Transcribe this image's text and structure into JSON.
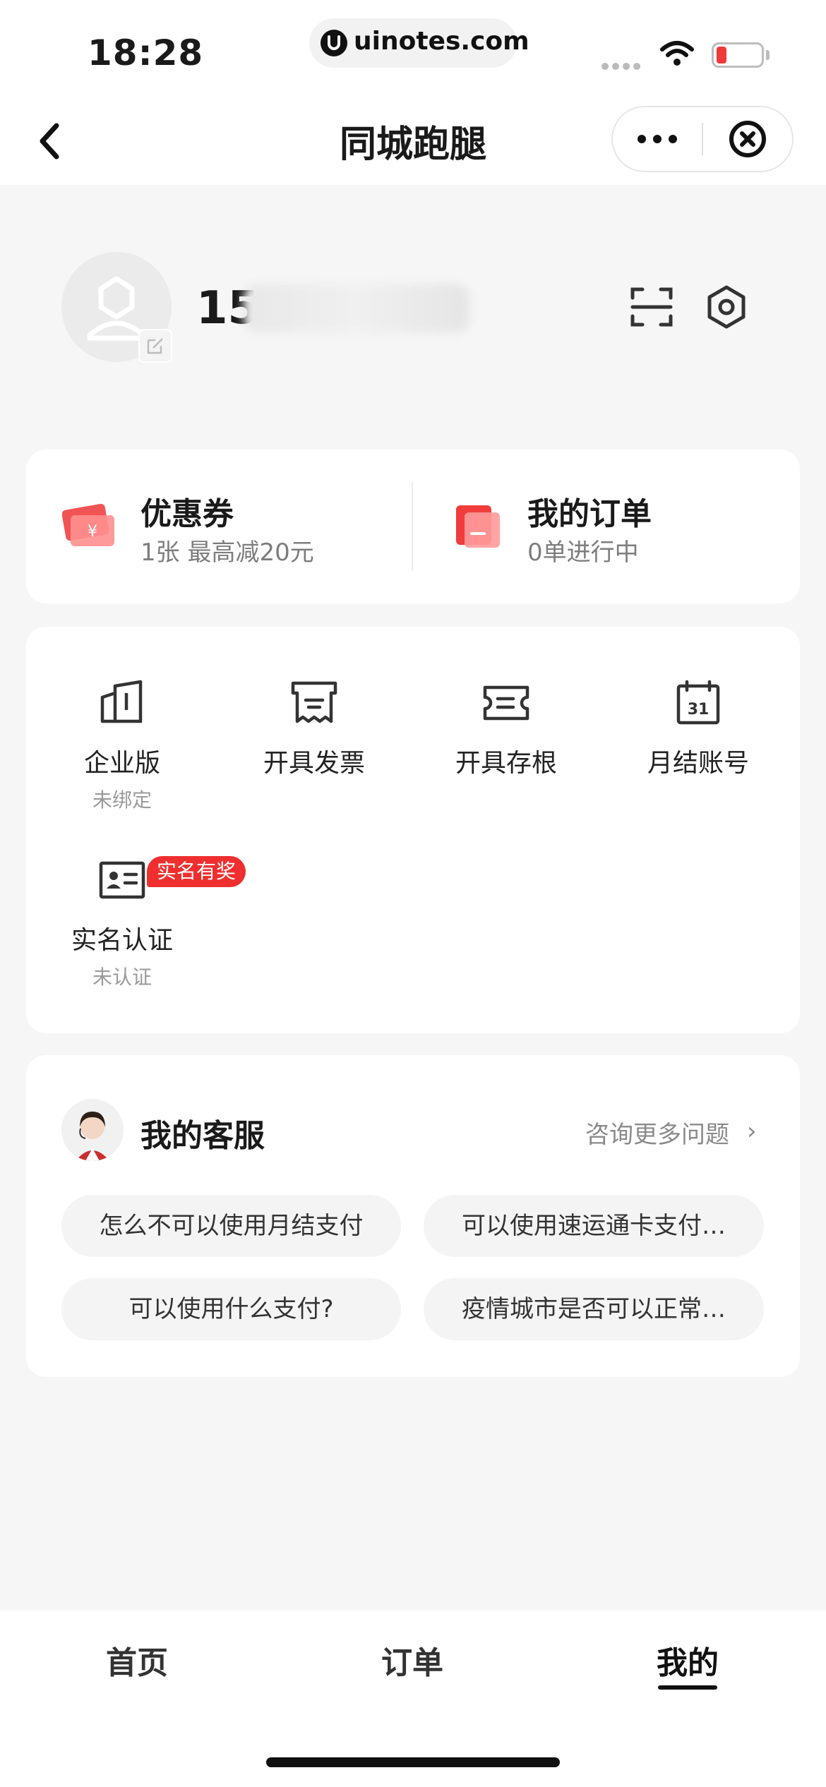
{
  "status_bar": {
    "time": "18:28",
    "url": "uinotes.com"
  },
  "header": {
    "title": "同城跑腿",
    "back_icon": "chevron-left-icon",
    "more_icon": "more-dots-icon",
    "close_icon": "close-circle-icon"
  },
  "profile": {
    "phone_visible": "15",
    "avatar_icon": "user-avatar-icon",
    "edit_icon": "edit-icon",
    "scan_icon": "scan-icon",
    "settings_icon": "settings-hex-icon"
  },
  "summary": {
    "coupon": {
      "title": "优惠券",
      "subtitle": "1张 最高减20元",
      "icon": "coupon-icon"
    },
    "orders": {
      "title": "我的订单",
      "subtitle": "0单进行中",
      "icon": "order-icon"
    }
  },
  "services": {
    "items": [
      {
        "label": "企业版",
        "sub": "未绑定",
        "icon": "building-icon"
      },
      {
        "label": "开具发票",
        "sub": "",
        "icon": "invoice-icon"
      },
      {
        "label": "开具存根",
        "sub": "",
        "icon": "ticket-stub-icon"
      },
      {
        "label": "月结账号",
        "sub": "",
        "icon": "calendar-icon"
      },
      {
        "label": "实名认证",
        "sub": "未认证",
        "icon": "id-card-icon",
        "badge": "实名有奖"
      }
    ],
    "calendar_day": "31"
  },
  "customer_service": {
    "title": "我的客服",
    "more_label": "咨询更多问题",
    "more_arrow": "›",
    "questions": [
      "怎么不可以使用月结支付",
      "可以使用速运通卡支付…",
      "可以使用什么支付?",
      "疫情城市是否可以正常…"
    ]
  },
  "tabbar": {
    "tabs": [
      "首页",
      "订单",
      "我的"
    ],
    "active_index": 2
  },
  "colors": {
    "accent_red": "#ef2f2f",
    "background": "#f6f6f6",
    "card": "#ffffff"
  }
}
